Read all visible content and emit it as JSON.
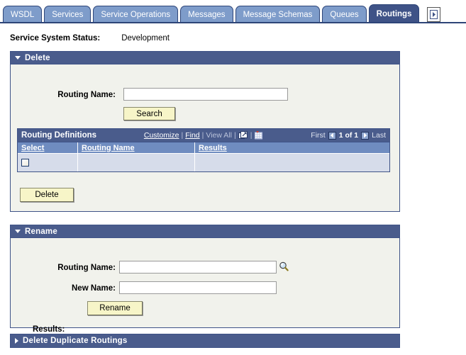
{
  "tabs": [
    {
      "label": "WSDL",
      "active": false
    },
    {
      "label": "Services",
      "active": false
    },
    {
      "label": "Service Operations",
      "active": false
    },
    {
      "label": "Messages",
      "active": false
    },
    {
      "label": "Message Schemas",
      "active": false
    },
    {
      "label": "Queues",
      "active": false
    },
    {
      "label": "Routings",
      "active": true
    }
  ],
  "tab_next_icon": "next-arrow-icon",
  "status": {
    "label": "Service System Status:",
    "value": "Development"
  },
  "delete_section": {
    "title": "Delete",
    "expanded": true,
    "twisty_icon": "triangle-down-icon",
    "routing_name_label": "Routing Name:",
    "routing_name_value": "",
    "routing_name_placeholder": "",
    "search_button": "Search",
    "delete_button": "Delete",
    "grid": {
      "caption": "Routing Definitions",
      "tools": {
        "customize": "Customize",
        "find": "Find",
        "view_all": "View All",
        "sep": "|",
        "expand_icon": "expand-grid-icon",
        "spreadsheet_icon": "download-spreadsheet-icon"
      },
      "nav": {
        "first": "First",
        "prev_icon": "prev-page-icon",
        "counter": "1 of 1",
        "next_icon": "next-page-icon",
        "last": "Last"
      },
      "columns": [
        "Select",
        "Routing Name",
        "Results"
      ],
      "rows": [
        {
          "select_checked": false,
          "routing_name": "",
          "results": ""
        }
      ]
    }
  },
  "rename_section": {
    "title": "Rename",
    "expanded": true,
    "twisty_icon": "triangle-down-icon",
    "routing_name_label": "Routing Name:",
    "routing_name_value": "",
    "lookup_icon": "magnifier-lookup-icon",
    "new_name_label": "New Name:",
    "new_name_value": "",
    "rename_button": "Rename",
    "results_label": "Results:"
  },
  "duplicates_section": {
    "title": "Delete Duplicate Routings",
    "expanded": false,
    "twisty_icon": "triangle-right-icon"
  },
  "colors": {
    "tab_inactive": "#7e9cca",
    "tab_active": "#3f5387",
    "panel_header": "#4a5c8c",
    "panel_body": "#f1f2ec",
    "grid_colhead": "#6f8cc0",
    "grid_row": "#d6dcea",
    "button_face": "#f7f5c8",
    "border": "#3f5387"
  }
}
